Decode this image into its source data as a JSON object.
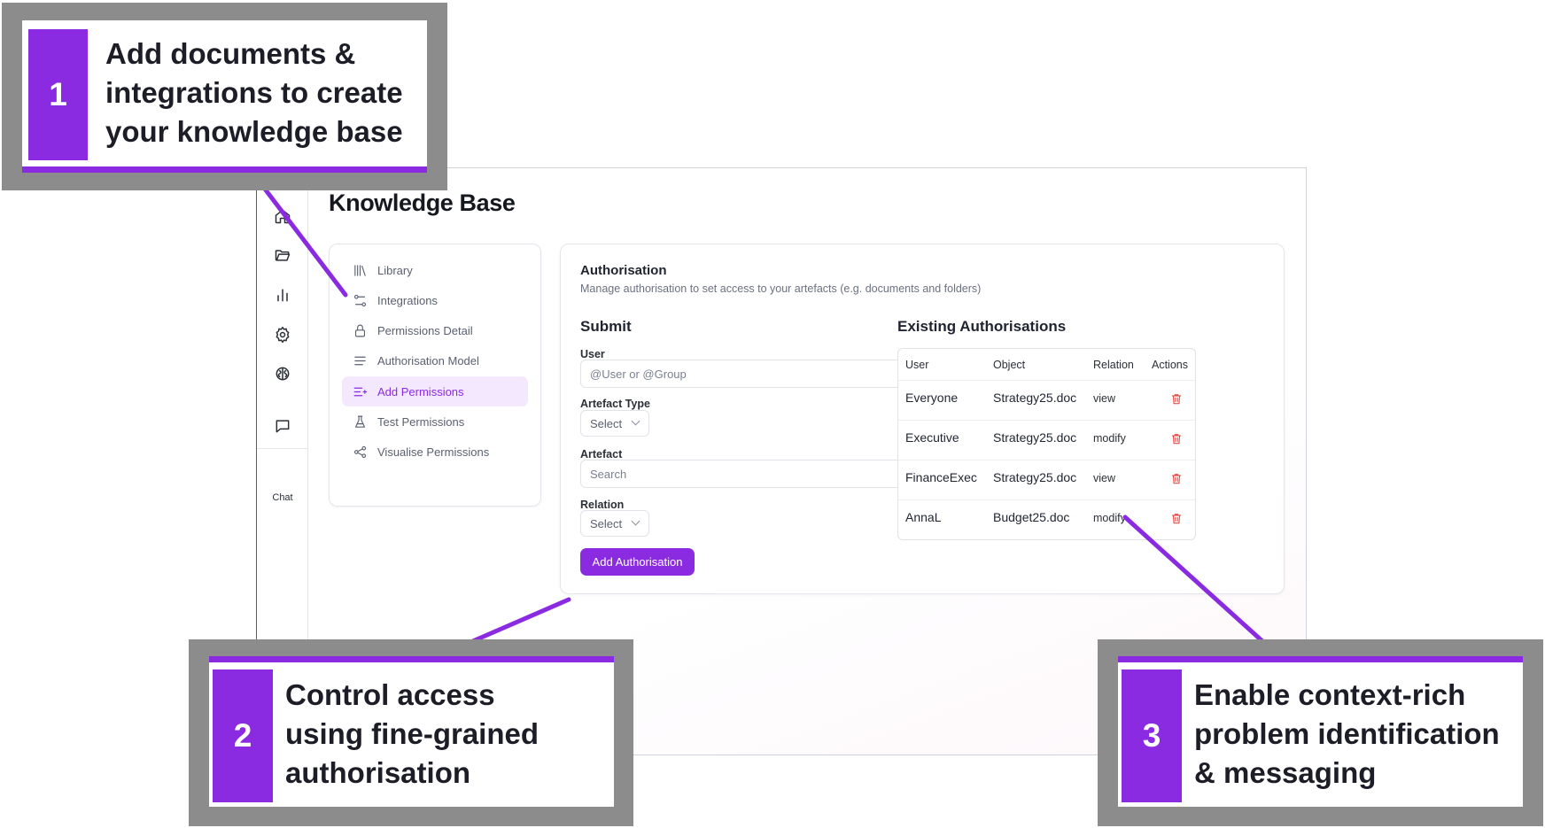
{
  "app": {
    "title": "Knowledge Base",
    "rail": {
      "collapse_label": "›",
      "icons": [
        "home-icon",
        "folder-open-icon",
        "bar-chart-icon",
        "settings-gear-icon",
        "brain-icon",
        "chat-icon"
      ],
      "chat_label": "Chat"
    },
    "subnav": [
      {
        "label": "Library",
        "icon": "library-icon",
        "active": false
      },
      {
        "label": "Integrations",
        "icon": "integrations-icon",
        "active": false
      },
      {
        "label": "Permissions Detail",
        "icon": "lock-icon",
        "active": false
      },
      {
        "label": "Authorisation Model",
        "icon": "lines-icon",
        "active": false
      },
      {
        "label": "Add Permissions",
        "icon": "add-list-icon",
        "active": true
      },
      {
        "label": "Test Permissions",
        "icon": "flask-icon",
        "active": false
      },
      {
        "label": "Visualise Permissions",
        "icon": "share-nodes-icon",
        "active": false
      }
    ],
    "panel": {
      "title": "Authorisation",
      "description": "Manage authorisation to set access to your artefacts (e.g. documents and folders)",
      "form": {
        "heading": "Submit",
        "user_label": "User",
        "user_placeholder": "@User or @Group",
        "artefact_type_label": "Artefact Type",
        "artefact_type_value": "Select",
        "artefact_label": "Artefact",
        "artefact_placeholder": "Search",
        "relation_label": "Relation",
        "relation_value": "Select",
        "submit_label": "Add Authorisation"
      },
      "existing": {
        "heading": "Existing Authorisations",
        "columns": [
          "User",
          "Object",
          "Relation",
          "Actions"
        ],
        "rows": [
          {
            "user": "Everyone",
            "object": "Strategy25.doc",
            "relation": "view"
          },
          {
            "user": "Executive",
            "object": "Strategy25.doc",
            "relation": "modify"
          },
          {
            "user": "FinanceExec",
            "object": "Strategy25.doc",
            "relation": "view"
          },
          {
            "user": "AnnaL",
            "object": "Budget25.doc",
            "relation": "modify"
          }
        ],
        "action_icon": "trash-icon"
      }
    }
  },
  "callouts": [
    {
      "number": "1",
      "lines": [
        "Add documents &",
        "integrations to create",
        "your knowledge base"
      ]
    },
    {
      "number": "2",
      "lines": [
        "Control access",
        "using fine-grained",
        "authorisation"
      ]
    },
    {
      "number": "3",
      "lines": [
        "Enable context-rich",
        "problem identification",
        "& messaging"
      ]
    }
  ],
  "colors": {
    "accent": "#8a2be2",
    "callout_frame": "#8c8c8c",
    "delete": "#e53935"
  }
}
